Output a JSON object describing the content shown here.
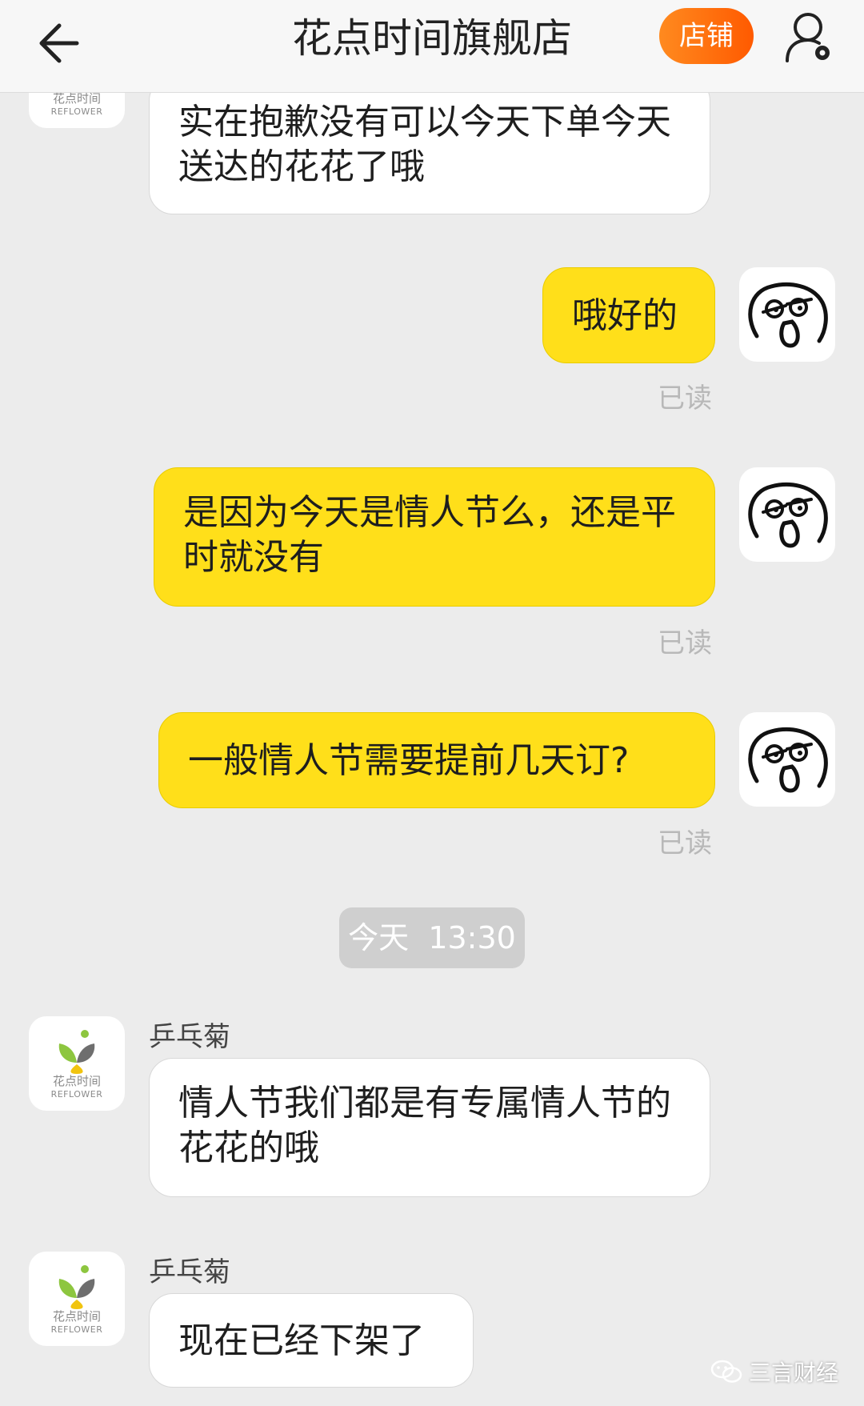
{
  "header": {
    "title": "花点时间旗舰店",
    "shop_button": "店铺",
    "back_icon": "back-arrow-icon",
    "user_icon": "user-settings-icon"
  },
  "shop_logo": {
    "name_cn": "花点时间",
    "name_en": "REFLOWER"
  },
  "messages": [
    {
      "from": "shop",
      "text": "实在抱歉没有可以今天下单今天送达的花花了哦"
    },
    {
      "from": "me",
      "text": "哦好的",
      "status": "已读"
    },
    {
      "from": "me",
      "text": "是因为今天是情人节么，还是平时就没有",
      "status": "已读"
    },
    {
      "from": "me",
      "text": "一般情人节需要提前几天订?",
      "status": "已读"
    },
    {
      "type": "time",
      "text": "今天  13:30"
    },
    {
      "from": "shop",
      "sender": "乒乓菊",
      "text": "情人节我们都是有专属情人节的花花的哦"
    },
    {
      "from": "shop",
      "sender": "乒乓菊",
      "text": "现在已经下架了"
    }
  ],
  "watermark": "三言财经",
  "colors": {
    "accent_orange": "#ff6a00",
    "bubble_yellow": "#ffdf1a",
    "background": "#ececec"
  }
}
